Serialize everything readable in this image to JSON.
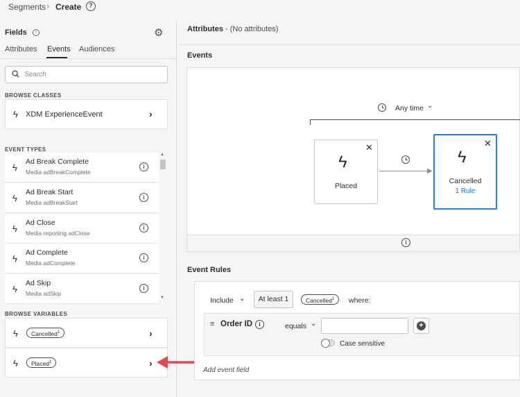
{
  "breadcrumb": {
    "parent": "Segments",
    "separator": "›",
    "current": "Create",
    "help": "?"
  },
  "fields": {
    "title": "Fields",
    "tabs": [
      {
        "label": "Attributes"
      },
      {
        "label": "Events"
      },
      {
        "label": "Audiences"
      }
    ],
    "search_placeholder": "Search",
    "browse_classes_label": "BROWSE CLASSES",
    "class_item": "XDM ExperienceEvent",
    "event_types_label": "EVENT TYPES",
    "event_types": [
      {
        "name": "Ad Break Complete",
        "sub": "Media adBreakComplete"
      },
      {
        "name": "Ad Break Start",
        "sub": "Media adBreakStart"
      },
      {
        "name": "Ad Close",
        "sub": "Media reporting adClose"
      },
      {
        "name": "Ad Complete",
        "sub": "Media adComplete"
      },
      {
        "name": "Ad Skip",
        "sub": "Media adSkip"
      }
    ],
    "browse_variables_label": "BROWSE VARIABLES",
    "variables": [
      {
        "label": "Cancelled",
        "sup": "1"
      },
      {
        "label": "Placed",
        "sup": "1"
      }
    ]
  },
  "attributes": {
    "title": "Attributes",
    "sub": " - (No attributes)"
  },
  "events": {
    "title": "Events",
    "time_window": "Any time",
    "nodes": [
      {
        "label": "Placed",
        "rule": ""
      },
      {
        "label": "Cancelled",
        "rule": "1 Rule"
      }
    ]
  },
  "event_rules": {
    "title": "Event Rules",
    "include": "Include",
    "at_least": "At least 1",
    "pill": {
      "label": "Cancelled",
      "sup": "1"
    },
    "where": "where:",
    "condition": {
      "field": "Order ID",
      "operator": "equals",
      "value": "",
      "case_sensitive_label": "Case sensitive"
    },
    "add_event_field": "Add event field"
  },
  "colors": {
    "accent": "#2680eb",
    "arrow": "#e34850"
  }
}
